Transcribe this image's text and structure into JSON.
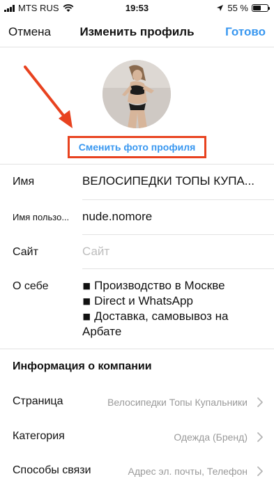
{
  "status_bar": {
    "carrier": "MTS RUS",
    "time": "19:53",
    "battery_text": "55 %",
    "battery_level": 0.55
  },
  "nav": {
    "cancel": "Отмена",
    "title": "Изменить профиль",
    "done": "Готово"
  },
  "profile": {
    "change_photo": "Сменить фото профиля"
  },
  "fields": {
    "name_label": "Имя",
    "name_value": "ВЕЛОСИПЕДКИ ТОПЫ КУПА...",
    "username_label": "Имя пользо...",
    "username_value": "nude.nomore",
    "site_label": "Сайт",
    "site_placeholder": "Сайт",
    "bio_label": "О себе",
    "bio_lines": [
      "◾ Производство в Москве",
      "◾ Direct и WhatsApp",
      "◾ Доставка, самовывоз на",
      "Арбате"
    ]
  },
  "company": {
    "header": "Информация о компании",
    "rows": [
      {
        "label": "Страница",
        "value": "Велосипедки Топы Купальники"
      },
      {
        "label": "Категория",
        "value": "Одежда (Бренд)"
      },
      {
        "label": "Способы связи",
        "value": "Адрес эл. почты, Телефон"
      }
    ]
  },
  "colors": {
    "accent": "#3897f0",
    "highlight": "#e8421f"
  }
}
